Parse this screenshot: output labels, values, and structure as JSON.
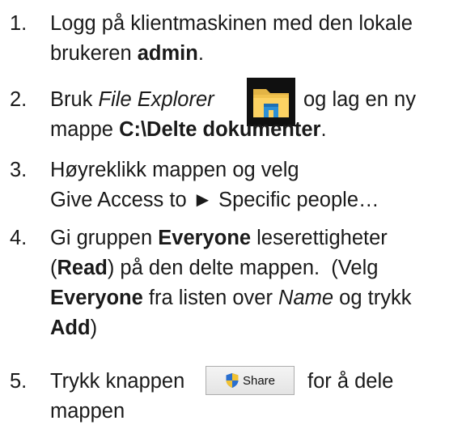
{
  "steps": [
    {
      "num": "1.",
      "lines": [
        [
          "Logg på klientmaskinen med den lokale"
        ],
        [
          "brukeren ",
          "admin",
          "."
        ]
      ]
    },
    {
      "num": "2.",
      "lines": [
        [
          "Bruk ",
          "File Explorer",
          "og lag en ny"
        ],
        [
          "mappe ",
          "C:\\Delte dokumenter",
          "."
        ]
      ]
    },
    {
      "num": "3.",
      "lines": [
        [
          "Høyreklikk mappen og velg"
        ],
        [
          "Give Access to ► Specific people…"
        ]
      ]
    },
    {
      "num": "4.",
      "lines": [
        [
          "Gi gruppen ",
          "Everyone",
          " leserettigheter"
        ],
        [
          "(",
          "Read",
          ") på den delte mappen.  (Velg"
        ],
        [
          "Everyone",
          " fra listen over ",
          "Name",
          " og trykk"
        ],
        [
          "Add",
          ")"
        ]
      ]
    },
    {
      "num": "5.",
      "lines": [
        [
          "Trykk knappen",
          "for å dele"
        ],
        [
          "mappen"
        ]
      ]
    }
  ],
  "icons": {
    "file_explorer": "file-explorer-icon",
    "shield": "uac-shield-icon"
  },
  "share_button": {
    "label": "Share"
  }
}
